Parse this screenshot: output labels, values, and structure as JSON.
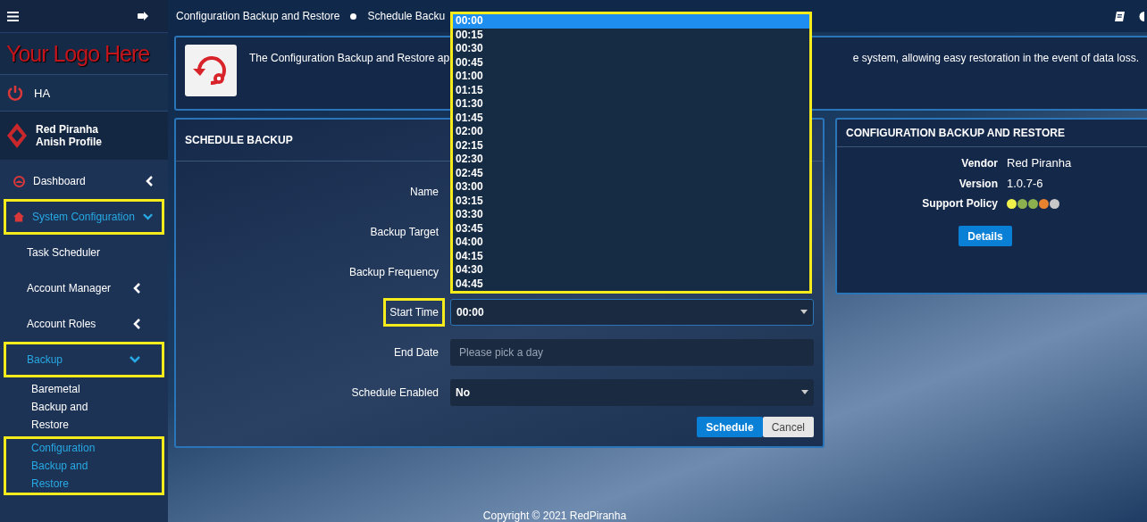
{
  "sidebar": {
    "logo": "Your Logo Here",
    "ha_label": "HA",
    "profile": {
      "name": "Red Piranha",
      "subtitle": "Anish Profile"
    },
    "items": [
      {
        "label": "Dashboard",
        "kind": "dashboard",
        "selected": false,
        "highlighted": false,
        "expanded": false
      },
      {
        "label": "System Configuration",
        "kind": "home",
        "selected": true,
        "highlighted": true,
        "expanded": true,
        "children": [
          {
            "label": "Task Scheduler",
            "selected": false,
            "highlighted": false
          },
          {
            "label": "Account Manager",
            "selected": false,
            "highlighted": false,
            "expanded": false
          },
          {
            "label": "Account Roles",
            "selected": false,
            "highlighted": false,
            "expanded": false
          },
          {
            "label": "Backup",
            "selected": true,
            "highlighted": true,
            "expanded": true,
            "children": [
              {
                "label": "Baremetal Backup and Restore",
                "selected": false,
                "highlighted": false
              },
              {
                "label": "Configuration Backup and Restore",
                "selected": true,
                "highlighted": true
              }
            ]
          }
        ]
      }
    ]
  },
  "breadcrumb": [
    "Configuration Backup and Restore",
    "Schedule Backu"
  ],
  "intro": {
    "text_start": "The Configuration Backup and Restore ap",
    "text_end": "e system, allowing easy restoration in the event of data loss."
  },
  "schedule_backup": {
    "title": "SCHEDULE BACKUP",
    "fields": [
      {
        "label": "Name",
        "kind": "hidden",
        "highlighted": false
      },
      {
        "label": "Backup Target",
        "kind": "hidden",
        "highlighted": false
      },
      {
        "label": "Backup Frequency",
        "kind": "hidden",
        "highlighted": false
      },
      {
        "label": "Start Time",
        "kind": "select",
        "value": "00:00",
        "open": true,
        "highlighted": true
      },
      {
        "label": "End Date",
        "kind": "date",
        "placeholder": "Please pick a day",
        "highlighted": false
      },
      {
        "label": "Schedule Enabled",
        "kind": "select",
        "value": "No",
        "open": false,
        "highlighted": false
      }
    ],
    "buttons": [
      {
        "label": "Schedule",
        "kind": "primary"
      },
      {
        "label": "Cancel",
        "kind": "secondary"
      }
    ]
  },
  "time_dropdown": {
    "highlighted": true,
    "options": [
      {
        "label": "00:00",
        "selected": true
      },
      {
        "label": "00:15",
        "selected": false
      },
      {
        "label": "00:30",
        "selected": false
      },
      {
        "label": "00:45",
        "selected": false
      },
      {
        "label": "01:00",
        "selected": false
      },
      {
        "label": "01:15",
        "selected": false
      },
      {
        "label": "01:30",
        "selected": false
      },
      {
        "label": "01:45",
        "selected": false
      },
      {
        "label": "02:00",
        "selected": false
      },
      {
        "label": "02:15",
        "selected": false
      },
      {
        "label": "02:30",
        "selected": false
      },
      {
        "label": "02:45",
        "selected": false
      },
      {
        "label": "03:00",
        "selected": false
      },
      {
        "label": "03:15",
        "selected": false
      },
      {
        "label": "03:30",
        "selected": false
      },
      {
        "label": "03:45",
        "selected": false
      },
      {
        "label": "04:00",
        "selected": false
      },
      {
        "label": "04:15",
        "selected": false
      },
      {
        "label": "04:30",
        "selected": false
      },
      {
        "label": "04:45",
        "selected": false
      }
    ]
  },
  "info_card": {
    "title": "CONFIGURATION BACKUP AND RESTORE",
    "rows": [
      {
        "label": "Vendor",
        "value": "Red Piranha"
      },
      {
        "label": "Version",
        "value": "1.0.7-6"
      }
    ],
    "support_policy": {
      "label": "Support Policy",
      "dots": [
        {
          "color": "#f0f04a"
        },
        {
          "color": "#8db04e"
        },
        {
          "color": "#8db04e"
        },
        {
          "color": "#e8822f"
        },
        {
          "color": "#c8c8c8"
        }
      ]
    },
    "button": "Details"
  },
  "footer": "Copyright © 2021 RedPiranha"
}
